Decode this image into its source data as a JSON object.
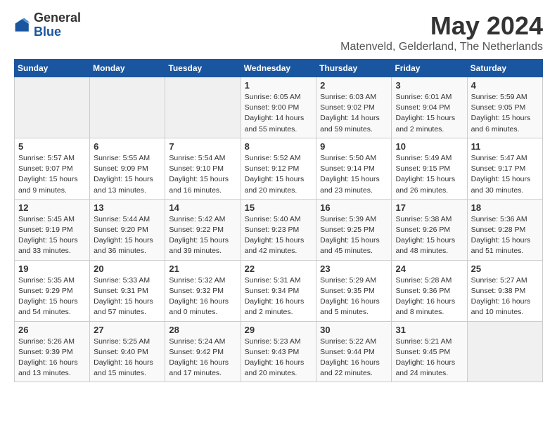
{
  "header": {
    "logo_general": "General",
    "logo_blue": "Blue",
    "month_title": "May 2024",
    "subtitle": "Matenveld, Gelderland, The Netherlands"
  },
  "weekdays": [
    "Sunday",
    "Monday",
    "Tuesday",
    "Wednesday",
    "Thursday",
    "Friday",
    "Saturday"
  ],
  "weeks": [
    [
      {
        "day": "",
        "info": ""
      },
      {
        "day": "",
        "info": ""
      },
      {
        "day": "",
        "info": ""
      },
      {
        "day": "1",
        "info": "Sunrise: 6:05 AM\nSunset: 9:00 PM\nDaylight: 14 hours\nand 55 minutes."
      },
      {
        "day": "2",
        "info": "Sunrise: 6:03 AM\nSunset: 9:02 PM\nDaylight: 14 hours\nand 59 minutes."
      },
      {
        "day": "3",
        "info": "Sunrise: 6:01 AM\nSunset: 9:04 PM\nDaylight: 15 hours\nand 2 minutes."
      },
      {
        "day": "4",
        "info": "Sunrise: 5:59 AM\nSunset: 9:05 PM\nDaylight: 15 hours\nand 6 minutes."
      }
    ],
    [
      {
        "day": "5",
        "info": "Sunrise: 5:57 AM\nSunset: 9:07 PM\nDaylight: 15 hours\nand 9 minutes."
      },
      {
        "day": "6",
        "info": "Sunrise: 5:55 AM\nSunset: 9:09 PM\nDaylight: 15 hours\nand 13 minutes."
      },
      {
        "day": "7",
        "info": "Sunrise: 5:54 AM\nSunset: 9:10 PM\nDaylight: 15 hours\nand 16 minutes."
      },
      {
        "day": "8",
        "info": "Sunrise: 5:52 AM\nSunset: 9:12 PM\nDaylight: 15 hours\nand 20 minutes."
      },
      {
        "day": "9",
        "info": "Sunrise: 5:50 AM\nSunset: 9:14 PM\nDaylight: 15 hours\nand 23 minutes."
      },
      {
        "day": "10",
        "info": "Sunrise: 5:49 AM\nSunset: 9:15 PM\nDaylight: 15 hours\nand 26 minutes."
      },
      {
        "day": "11",
        "info": "Sunrise: 5:47 AM\nSunset: 9:17 PM\nDaylight: 15 hours\nand 30 minutes."
      }
    ],
    [
      {
        "day": "12",
        "info": "Sunrise: 5:45 AM\nSunset: 9:19 PM\nDaylight: 15 hours\nand 33 minutes."
      },
      {
        "day": "13",
        "info": "Sunrise: 5:44 AM\nSunset: 9:20 PM\nDaylight: 15 hours\nand 36 minutes."
      },
      {
        "day": "14",
        "info": "Sunrise: 5:42 AM\nSunset: 9:22 PM\nDaylight: 15 hours\nand 39 minutes."
      },
      {
        "day": "15",
        "info": "Sunrise: 5:40 AM\nSunset: 9:23 PM\nDaylight: 15 hours\nand 42 minutes."
      },
      {
        "day": "16",
        "info": "Sunrise: 5:39 AM\nSunset: 9:25 PM\nDaylight: 15 hours\nand 45 minutes."
      },
      {
        "day": "17",
        "info": "Sunrise: 5:38 AM\nSunset: 9:26 PM\nDaylight: 15 hours\nand 48 minutes."
      },
      {
        "day": "18",
        "info": "Sunrise: 5:36 AM\nSunset: 9:28 PM\nDaylight: 15 hours\nand 51 minutes."
      }
    ],
    [
      {
        "day": "19",
        "info": "Sunrise: 5:35 AM\nSunset: 9:29 PM\nDaylight: 15 hours\nand 54 minutes."
      },
      {
        "day": "20",
        "info": "Sunrise: 5:33 AM\nSunset: 9:31 PM\nDaylight: 15 hours\nand 57 minutes."
      },
      {
        "day": "21",
        "info": "Sunrise: 5:32 AM\nSunset: 9:32 PM\nDaylight: 16 hours\nand 0 minutes."
      },
      {
        "day": "22",
        "info": "Sunrise: 5:31 AM\nSunset: 9:34 PM\nDaylight: 16 hours\nand 2 minutes."
      },
      {
        "day": "23",
        "info": "Sunrise: 5:29 AM\nSunset: 9:35 PM\nDaylight: 16 hours\nand 5 minutes."
      },
      {
        "day": "24",
        "info": "Sunrise: 5:28 AM\nSunset: 9:36 PM\nDaylight: 16 hours\nand 8 minutes."
      },
      {
        "day": "25",
        "info": "Sunrise: 5:27 AM\nSunset: 9:38 PM\nDaylight: 16 hours\nand 10 minutes."
      }
    ],
    [
      {
        "day": "26",
        "info": "Sunrise: 5:26 AM\nSunset: 9:39 PM\nDaylight: 16 hours\nand 13 minutes."
      },
      {
        "day": "27",
        "info": "Sunrise: 5:25 AM\nSunset: 9:40 PM\nDaylight: 16 hours\nand 15 minutes."
      },
      {
        "day": "28",
        "info": "Sunrise: 5:24 AM\nSunset: 9:42 PM\nDaylight: 16 hours\nand 17 minutes."
      },
      {
        "day": "29",
        "info": "Sunrise: 5:23 AM\nSunset: 9:43 PM\nDaylight: 16 hours\nand 20 minutes."
      },
      {
        "day": "30",
        "info": "Sunrise: 5:22 AM\nSunset: 9:44 PM\nDaylight: 16 hours\nand 22 minutes."
      },
      {
        "day": "31",
        "info": "Sunrise: 5:21 AM\nSunset: 9:45 PM\nDaylight: 16 hours\nand 24 minutes."
      },
      {
        "day": "",
        "info": ""
      }
    ]
  ]
}
